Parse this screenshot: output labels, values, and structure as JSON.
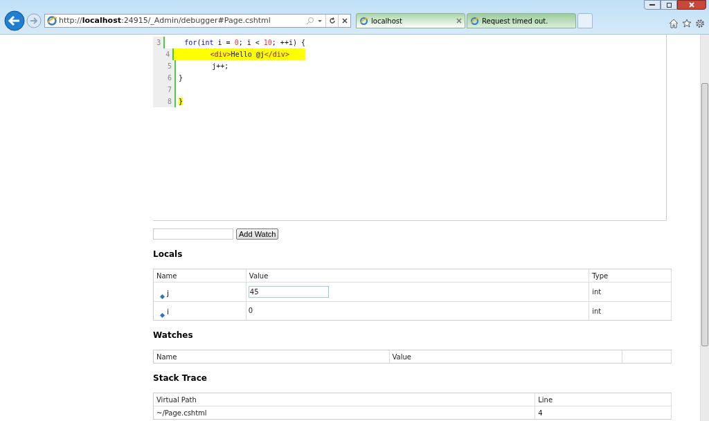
{
  "browser": {
    "address": {
      "prefix": "http://",
      "host": "localhost",
      "rest": ":24915/_Admin/debugger#Page.cshtml"
    },
    "tabs": [
      {
        "label": "localhost",
        "selected": true
      },
      {
        "label": "Request timed out.",
        "selected": false
      }
    ]
  },
  "code": {
    "lines": [
      {
        "number": "3",
        "highlighted": false,
        "segments": [
          {
            "kind": "keyword",
            "text": "    for",
            "highlighted": false
          },
          {
            "kind": "plain",
            "text": "(",
            "highlighted": false
          },
          {
            "kind": "keyword",
            "text": "int",
            "highlighted": false
          },
          {
            "kind": "plain",
            "text": " i = ",
            "highlighted": false
          },
          {
            "kind": "number",
            "text": "0",
            "highlighted": false
          },
          {
            "kind": "plain",
            "text": "; i < ",
            "highlighted": false
          },
          {
            "kind": "number",
            "text": "10",
            "highlighted": false
          },
          {
            "kind": "plain",
            "text": "; ++i) {",
            "highlighted": false
          }
        ]
      },
      {
        "number": "4",
        "highlighted": true,
        "segments": [
          {
            "kind": "tag",
            "text": "        <div>"
          },
          {
            "kind": "plain",
            "text": "Hello @j"
          },
          {
            "kind": "tag",
            "text": "</div>"
          }
        ]
      },
      {
        "number": "5",
        "highlighted": false,
        "segments": [
          {
            "kind": "plain",
            "text": "        j++;",
            "highlighted": false
          }
        ]
      },
      {
        "number": "6",
        "highlighted": false,
        "segments": [
          {
            "kind": "plain",
            "text": "}",
            "highlighted": false
          }
        ]
      },
      {
        "number": "7",
        "highlighted": false
      },
      {
        "number": "8",
        "highlighted": false,
        "segments": [
          {
            "kind": "plain",
            "text": "}",
            "highlighted": true
          }
        ]
      }
    ]
  },
  "watch_form": {
    "button": "Add Watch"
  },
  "locals": {
    "title": "Locals",
    "columns": [
      "Name",
      "Value",
      "Type"
    ],
    "rows": [
      {
        "name": "j",
        "value": "45",
        "type": "int",
        "editing": true
      },
      {
        "name": "i",
        "value": "0",
        "type": "int",
        "editing": false
      }
    ]
  },
  "watches": {
    "title": "Watches",
    "columns": [
      "Name",
      "Value"
    ]
  },
  "stack_trace": {
    "title": "Stack Trace",
    "columns": [
      "Virtual Path",
      "Line"
    ],
    "rows": [
      {
        "path": "~/Page.cshtml",
        "line": "4"
      }
    ]
  }
}
